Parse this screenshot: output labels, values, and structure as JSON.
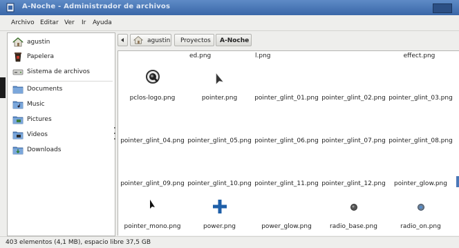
{
  "window": {
    "title": "A-Noche - Administrador de archivos"
  },
  "menubar": {
    "items": [
      {
        "label": "Archivo"
      },
      {
        "label": "Editar"
      },
      {
        "label": "Ver"
      },
      {
        "label": "Ir"
      },
      {
        "label": "Ayuda"
      }
    ]
  },
  "sidebar": {
    "places": [
      {
        "label": "agustin",
        "icon": "home-icon"
      },
      {
        "label": "Papelera",
        "icon": "trash-icon"
      },
      {
        "label": "Sistema de archivos",
        "icon": "drive-icon"
      }
    ],
    "bookmarks": [
      {
        "label": "Documents",
        "icon": "folder-icon"
      },
      {
        "label": "Music",
        "icon": "folder-music-icon"
      },
      {
        "label": "Pictures",
        "icon": "folder-pictures-icon"
      },
      {
        "label": "Videos",
        "icon": "folder-videos-icon"
      },
      {
        "label": "Downloads",
        "icon": "folder-downloads-icon"
      }
    ]
  },
  "pathbar": {
    "back_icon": "chevron-left-icon",
    "crumbs": [
      {
        "label": "agustin",
        "icon": "home-icon"
      },
      {
        "label": "Proyectos"
      },
      {
        "label": "A-Noche",
        "active": true
      }
    ]
  },
  "files": {
    "partial_row": [
      "ed.png",
      "l.png",
      "",
      "",
      "effect.png"
    ],
    "items": [
      {
        "name": "pclos-logo.png",
        "icon": "pclos-logo-icon"
      },
      {
        "name": "pointer.png",
        "icon": "cursor-icon"
      },
      {
        "name": "pointer_glint_01.png",
        "icon": ""
      },
      {
        "name": "pointer_glint_02.png",
        "icon": ""
      },
      {
        "name": "pointer_glint_03.png",
        "icon": ""
      },
      {
        "name": "pointer_glint_04.png",
        "icon": ""
      },
      {
        "name": "pointer_glint_05.png",
        "icon": ""
      },
      {
        "name": "pointer_glint_06.png",
        "icon": ""
      },
      {
        "name": "pointer_glint_07.png",
        "icon": ""
      },
      {
        "name": "pointer_glint_08.png",
        "icon": ""
      },
      {
        "name": "pointer_glint_09.png",
        "icon": ""
      },
      {
        "name": "pointer_glint_10.png",
        "icon": ""
      },
      {
        "name": "pointer_glint_11.png",
        "icon": ""
      },
      {
        "name": "pointer_glint_12.png",
        "icon": ""
      },
      {
        "name": "pointer_glow.png",
        "icon": ""
      },
      {
        "name": "pointer_mono.png",
        "icon": "cursor-mono-icon"
      },
      {
        "name": "power.png",
        "icon": "plus-icon"
      },
      {
        "name": "power_glow.png",
        "icon": ""
      },
      {
        "name": "radio_base.png",
        "icon": "radio-dot-icon"
      },
      {
        "name": "radio_on.png",
        "icon": "radio-dot-blue-icon"
      }
    ]
  },
  "status": {
    "text": "403 elementos (4,1 MB), espacio libre 37,5 GB"
  },
  "colors": {
    "titlebar": "#4a78b8",
    "accent_plus": "#1f5fa8"
  }
}
